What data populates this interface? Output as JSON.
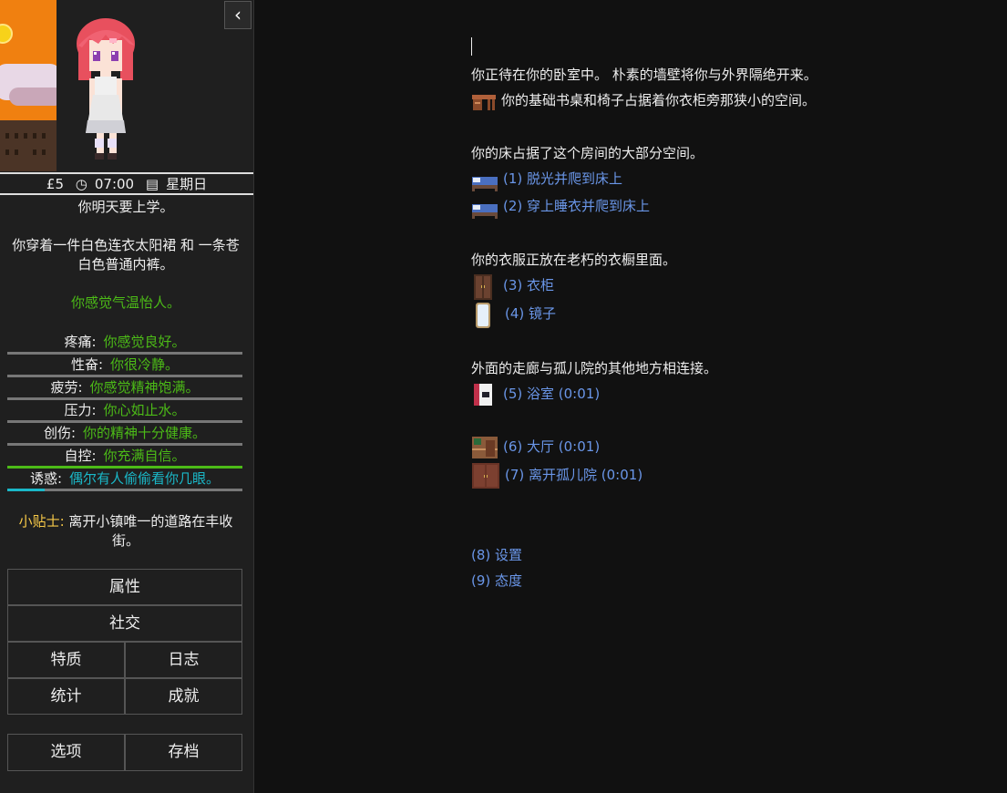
{
  "sidebar": {
    "status": {
      "money": "£5",
      "time": "07:00",
      "day": "星期日"
    },
    "school_note": "你明天要上学。",
    "clothing": "你穿着一件白色连衣太阳裙 和 一条苍白色普通内裤。",
    "weather": "你感觉气温怡人。",
    "stats": [
      {
        "label": "疼痛:",
        "desc": "你感觉良好。",
        "fill": 0,
        "color": "#4cbb17",
        "text_color": "green"
      },
      {
        "label": "性奋:",
        "desc": "你很冷静。",
        "fill": 0,
        "color": "#4cbb17",
        "text_color": "green"
      },
      {
        "label": "疲劳:",
        "desc": "你感觉精神饱满。",
        "fill": 0,
        "color": "#4cbb17",
        "text_color": "green"
      },
      {
        "label": "压力:",
        "desc": "你心如止水。",
        "fill": 0,
        "color": "#4cbb17",
        "text_color": "green"
      },
      {
        "label": "创伤:",
        "desc": "你的精神十分健康。",
        "fill": 0,
        "color": "#4cbb17",
        "text_color": "green"
      },
      {
        "label": "自控:",
        "desc": "你充满自信。",
        "fill": 1,
        "color": "#4cbb17",
        "text_color": "green"
      },
      {
        "label": "诱惑:",
        "desc": "偶尔有人偷偷看你几眼。",
        "fill": 0.16,
        "color": "#1ab8c8",
        "text_color": "cyan"
      }
    ],
    "tip_label": "小贴士:",
    "tip_text": "离开小镇唯一的道路在丰收街。",
    "buttons": {
      "attributes": "属性",
      "social": "社交",
      "traits": "特质",
      "journal": "日志",
      "statistics": "统计",
      "achievements": "成就",
      "options": "选项",
      "saves": "存档"
    },
    "collapse_icon": "chevron-left-icon"
  },
  "main": {
    "intro": "你正待在你的卧室中。 朴素的墙壁将你与外界隔绝开来。",
    "desk": "你的基础书桌和椅子占据着你衣柜旁那狭小的空间。",
    "bed_desc": "你的床占据了这个房间的大部分空间。",
    "bed_links": [
      "(1) 脱光并爬到床上",
      "(2) 穿上睡衣并爬到床上"
    ],
    "clothes_desc": "你的衣服正放在老朽的衣橱里面。",
    "clothes_links": [
      "(3) 衣柜",
      "(4) 镜子"
    ],
    "hall_desc": "外面的走廊与孤儿院的其他地方相连接。",
    "bath_link": "(5) 浴室 (0:01)",
    "hall_links": [
      "(6) 大厅 (0:01)",
      "(7) 离开孤儿院 (0:01)"
    ],
    "settings_link": "(8) 设置",
    "attitude_link": "(9) 态度"
  }
}
